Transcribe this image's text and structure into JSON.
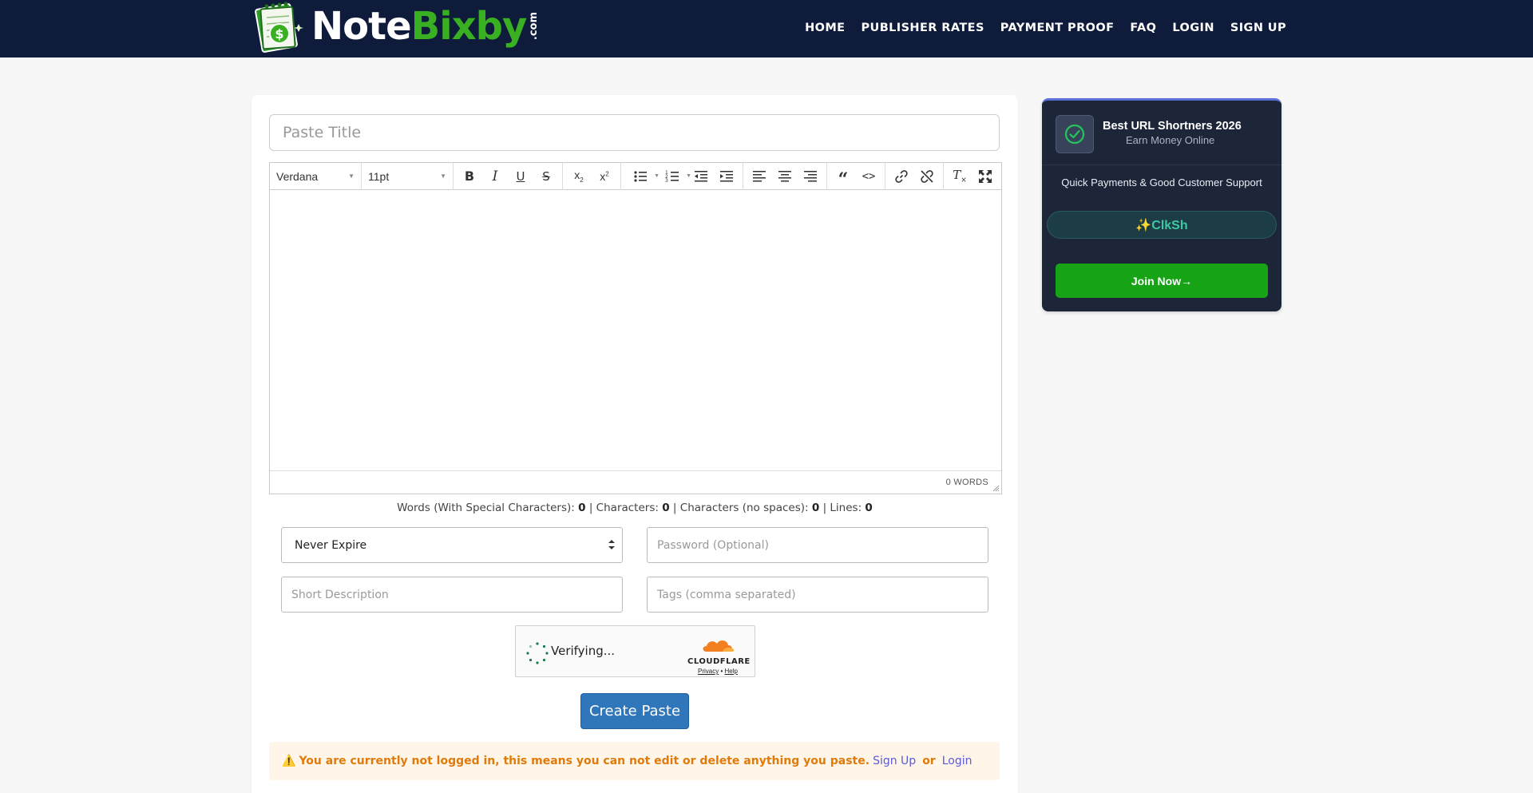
{
  "header": {
    "logo": {
      "word_white": "Note",
      "word_green": "Bixby",
      "domain": ".com"
    },
    "nav": [
      {
        "label": "HOME",
        "name": "nav-home"
      },
      {
        "label": "PUBLISHER RATES",
        "name": "nav-publisher-rates"
      },
      {
        "label": "PAYMENT PROOF",
        "name": "nav-payment-proof"
      },
      {
        "label": "FAQ",
        "name": "nav-faq"
      },
      {
        "label": "LOGIN",
        "name": "nav-login"
      },
      {
        "label": "SIGN UP",
        "name": "nav-sign-up"
      }
    ]
  },
  "form": {
    "title_placeholder": "Paste Title",
    "editor": {
      "font_family": "Verdana",
      "font_size": "11pt",
      "word_count": "0 WORDS"
    },
    "counts": {
      "words_label": "Words (With Special Characters):",
      "words": "0",
      "chars_label": "| Characters:",
      "chars": "0",
      "chars_nospace_label": "| Characters (no spaces):",
      "chars_nospace": "0",
      "lines_label": "| Lines:",
      "lines": "0"
    },
    "expiry": {
      "selected": "Never Expire",
      "options": [
        "Never Expire"
      ]
    },
    "password_placeholder": "Password (Optional)",
    "description_placeholder": "Short Description",
    "tags_placeholder": "Tags (comma separated)",
    "captcha": {
      "status": "Verifying...",
      "brand": "CLOUDFLARE",
      "privacy": "Privacy",
      "sep": "•",
      "help": "Help"
    },
    "submit_label": "Create Paste",
    "warning": {
      "icon": "⚠️",
      "message": "You are currently not logged in, this means you can not edit or delete anything you paste.",
      "signup": "Sign Up",
      "or": "or",
      "login": "Login"
    }
  },
  "ad": {
    "title": "Best URL Shortners 2026",
    "subtitle": "Earn Money Online",
    "support": "Quick Payments & Good Customer Support",
    "brand": "✨ClkSh",
    "cta": "Join Now→"
  },
  "colors": {
    "navbar": "#0f1b3a",
    "logo_green": "#39b021",
    "primary_button": "#2f76ba",
    "warning_text": "#e07b0a",
    "ad_join": "#16a316"
  }
}
